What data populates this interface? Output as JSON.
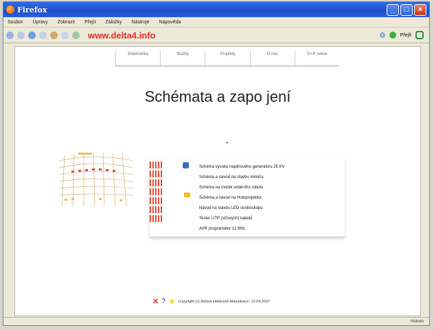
{
  "window": {
    "title": "Firefox"
  },
  "menu": [
    "Soubor",
    "Úpravy",
    "Zobrazit",
    "Přejít",
    "Záložky",
    "Nástroje",
    "Nápověda"
  ],
  "toolbar": {
    "url": "www.delta4.info",
    "go_label": "Přejít"
  },
  "tabs": [
    "Elektronika",
    "Služby",
    "Projekty",
    "O nás",
    "V.I.P sekce"
  ],
  "page": {
    "heading": "Schémata a zapo jení",
    "links": [
      "Schéma vysoko napěťového generátoru 25 KV",
      "Schéma a návod na stavbu měniču",
      "Schéma na model solárního robotu",
      "Schéma a návod na Holoprojektor.",
      "Návod na stavbu LED stroboskopu",
      "Tester UTP (síťových) kabelů",
      "AVR programátor 11.5Kb."
    ],
    "footer": "Copyright (c) Delta4.elektronik Aktualizace: 12.04.2007"
  },
  "status": {
    "text": "Hotovo"
  },
  "colors": {
    "url_red": "#e0302a",
    "titlebar_blue": "#1d4fc8"
  }
}
